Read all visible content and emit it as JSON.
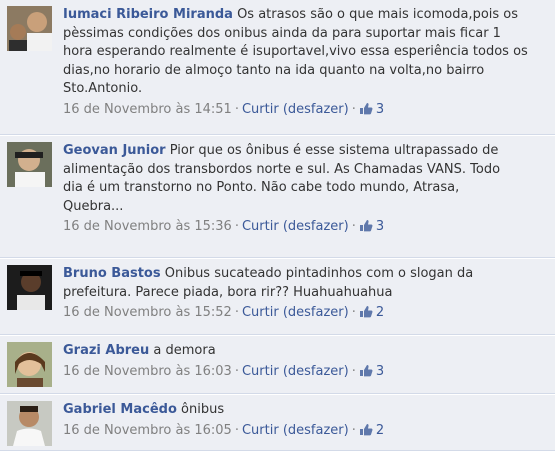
{
  "comments": [
    {
      "author": "Iumaci Ribeiro Miranda",
      "text": "Os atrasos são o que mais icomoda,pois os pèssimas condições dos onibus ainda da para suportar mais ficar 1 hora esperando realmente é isuportavel,vivo essa esperiência todos os dias,no horario de almoço tanto na ida quanto na volta,no bairro Sto.Antonio.",
      "time": "16 de Novembro às 14:51",
      "like_label": "Curtir",
      "undo_label": "(desfazer)",
      "likes": "3"
    },
    {
      "author": "Geovan Junior",
      "text": "Pior que os ônibus é esse sistema ultrapassado de alimentação dos transbordos norte e sul. As Chamadas VANS. Todo dia é um transtorno no Ponto. Não cabe todo mundo, Atrasa, Quebra...",
      "time": "16 de Novembro às 15:36",
      "like_label": "Curtir",
      "undo_label": "(desfazer)",
      "likes": "3"
    },
    {
      "author": "Bruno Bastos",
      "text": "Onibus sucateado pintadinhos com o slogan da prefeitura. Parece piada, bora rir?? Huahuahuahua",
      "time": "16 de Novembro às 15:52",
      "like_label": "Curtir",
      "undo_label": "(desfazer)",
      "likes": "2"
    },
    {
      "author": "Grazi Abreu",
      "text": "a demora",
      "time": "16 de Novembro às 16:03",
      "like_label": "Curtir",
      "undo_label": "(desfazer)",
      "likes": "3"
    },
    {
      "author": "Gabriel Macêdo",
      "text": "ônibus",
      "time": "16 de Novembro às 16:05",
      "like_label": "Curtir",
      "undo_label": "(desfazer)",
      "likes": "2"
    }
  ],
  "separator": "·",
  "icons": {
    "like": "thumbs-up-icon",
    "avatar": "user-photo"
  },
  "colors": {
    "link": "#3b5998",
    "meta": "#808080",
    "background": "#edeff4"
  }
}
